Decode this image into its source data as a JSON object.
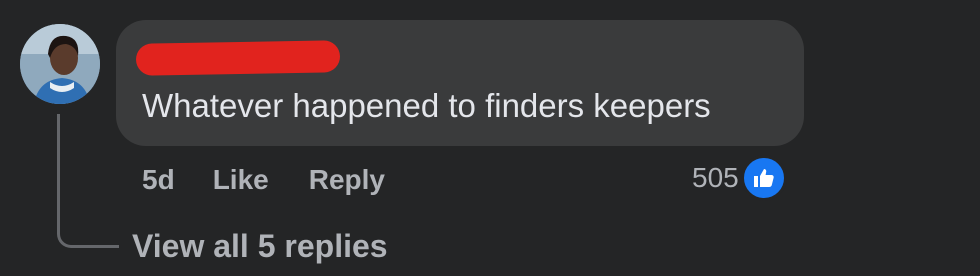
{
  "comment": {
    "author_name": "...",
    "text": "Whatever happened to finders keepers",
    "timestamp": "5d",
    "like_label": "Like",
    "reply_label": "Reply",
    "reaction_count": "505",
    "reaction_icon": "thumbs-up-icon",
    "view_replies_label": "View all 5 replies"
  },
  "colors": {
    "background": "#242526",
    "bubble": "#3a3b3c",
    "text_primary": "#e4e6eb",
    "text_secondary": "#b0b3b8",
    "like_blue": "#1877f2",
    "redaction_red": "#e1231e"
  }
}
